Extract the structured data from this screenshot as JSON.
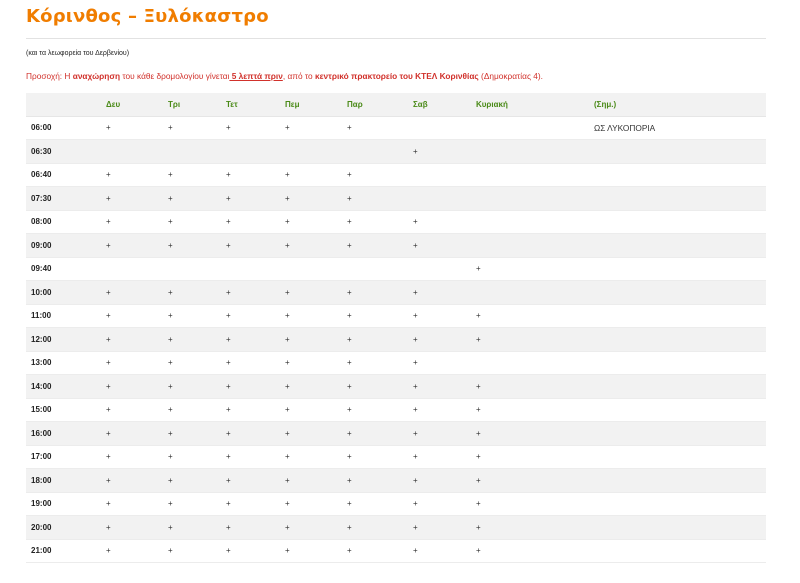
{
  "page": {
    "title": "Κόρινθος – Ξυλόκαστρο",
    "subnote": "(και τα λεωφορεία του Δερβενίου)",
    "notice": {
      "part1": "Προσοχή: Η ",
      "bold1": "αναχώρηση",
      "part2": " του κάθε δρομολογίου γίνεται",
      "underline": " 5 λεπτά πριν",
      "part3": ", από το ",
      "bold2": "κεντρικό πρακτορείο του ΚΤΕΛ Κορινθίας",
      "part4": " (Δημοκρατίας 4)."
    }
  },
  "table": {
    "headers": [
      "",
      "Δευ",
      "Τρι",
      "Τετ",
      "Πεμ",
      "Παρ",
      "Σαβ",
      "Κυριακή",
      "(Σημ.)"
    ],
    "rows": [
      {
        "time": "06:00",
        "marks": [
          "+",
          "+",
          "+",
          "+",
          "+",
          "",
          ""
        ],
        "note": "ΩΣ ΛΥΚΟΠΟΡΙΑ"
      },
      {
        "time": "06:30",
        "marks": [
          "",
          "",
          "",
          "",
          "",
          "+",
          ""
        ],
        "note": ""
      },
      {
        "time": "06:40",
        "marks": [
          "+",
          "+",
          "+",
          "+",
          "+",
          "",
          ""
        ],
        "note": ""
      },
      {
        "time": "07:30",
        "marks": [
          "+",
          "+",
          "+",
          "+",
          "+",
          "",
          ""
        ],
        "note": ""
      },
      {
        "time": "08:00",
        "marks": [
          "+",
          "+",
          "+",
          "+",
          "+",
          "+",
          ""
        ],
        "note": ""
      },
      {
        "time": "09:00",
        "marks": [
          "+",
          "+",
          "+",
          "+",
          "+",
          "+",
          ""
        ],
        "note": ""
      },
      {
        "time": "09:40",
        "marks": [
          "",
          "",
          "",
          "",
          "",
          "",
          "+"
        ],
        "note": ""
      },
      {
        "time": "10:00",
        "marks": [
          "+",
          "+",
          "+",
          "+",
          "+",
          "+",
          ""
        ],
        "note": ""
      },
      {
        "time": "11:00",
        "marks": [
          "+",
          "+",
          "+",
          "+",
          "+",
          "+",
          "+"
        ],
        "note": ""
      },
      {
        "time": "12:00",
        "marks": [
          "+",
          "+",
          "+",
          "+",
          "+",
          "+",
          "+"
        ],
        "note": ""
      },
      {
        "time": "13:00",
        "marks": [
          "+",
          "+",
          "+",
          "+",
          "+",
          "+",
          ""
        ],
        "note": ""
      },
      {
        "time": "14:00",
        "marks": [
          "+",
          "+",
          "+",
          "+",
          "+",
          "+",
          "+"
        ],
        "note": ""
      },
      {
        "time": "15:00",
        "marks": [
          "+",
          "+",
          "+",
          "+",
          "+",
          "+",
          "+"
        ],
        "note": ""
      },
      {
        "time": "16:00",
        "marks": [
          "+",
          "+",
          "+",
          "+",
          "+",
          "+",
          "+"
        ],
        "note": ""
      },
      {
        "time": "17:00",
        "marks": [
          "+",
          "+",
          "+",
          "+",
          "+",
          "+",
          "+"
        ],
        "note": ""
      },
      {
        "time": "18:00",
        "marks": [
          "+",
          "+",
          "+",
          "+",
          "+",
          "+",
          "+"
        ],
        "note": ""
      },
      {
        "time": "19:00",
        "marks": [
          "+",
          "+",
          "+",
          "+",
          "+",
          "+",
          "+"
        ],
        "note": ""
      },
      {
        "time": "20:00",
        "marks": [
          "+",
          "+",
          "+",
          "+",
          "+",
          "+",
          "+"
        ],
        "note": ""
      },
      {
        "time": "21:00",
        "marks": [
          "+",
          "+",
          "+",
          "+",
          "+",
          "+",
          "+"
        ],
        "note": ""
      }
    ]
  },
  "colors": {
    "title": "#f07d00",
    "header_text": "#4a8a17",
    "notice_text": "#d1312b",
    "row_alt": "#f2f2f2"
  }
}
